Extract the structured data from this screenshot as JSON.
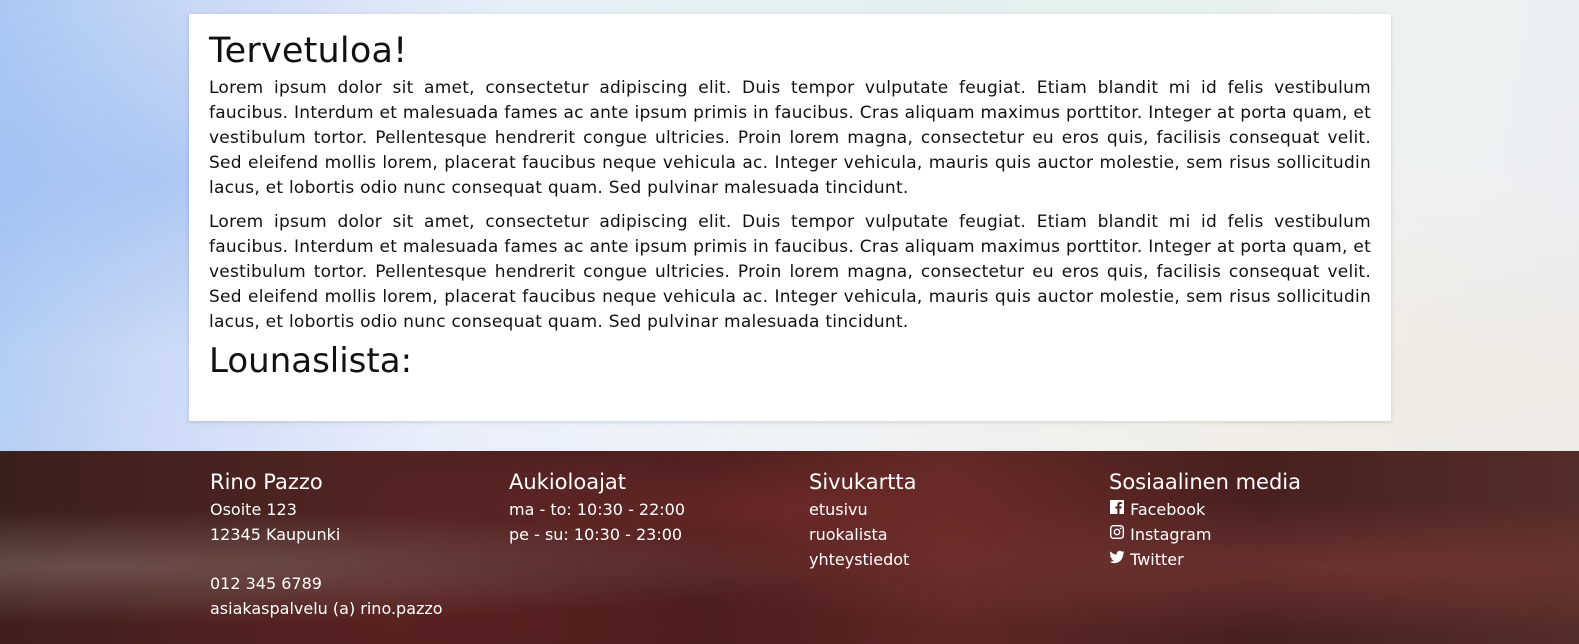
{
  "main": {
    "welcome_title": "Tervetuloa!",
    "paragraphs": [
      "Lorem ipsum dolor sit amet, consectetur adipiscing elit. Duis tempor vulputate feugiat. Etiam blandit mi id felis vestibulum faucibus. Interdum et malesuada fames ac ante ipsum primis in faucibus. Cras aliquam maximus porttitor. Integer at porta quam, et vestibulum tortor. Pellentesque hendrerit congue ultricies. Proin lorem magna, consectetur eu eros quis, facilisis consequat velit. Sed eleifend mollis lorem, placerat faucibus neque vehicula ac. Integer vehicula, mauris quis auctor molestie, sem risus sollicitudin lacus, et lobortis odio nunc consequat quam. Sed pulvinar malesuada tincidunt.",
      "Lorem ipsum dolor sit amet, consectetur adipiscing elit. Duis tempor vulputate feugiat. Etiam blandit mi id felis vestibulum faucibus. Interdum et malesuada fames ac ante ipsum primis in faucibus. Cras aliquam maximus porttitor. Integer at porta quam, et vestibulum tortor. Pellentesque hendrerit congue ultricies. Proin lorem magna, consectetur eu eros quis, facilisis consequat velit. Sed eleifend mollis lorem, placerat faucibus neque vehicula ac. Integer vehicula, mauris quis auctor molestie, sem risus sollicitudin lacus, et lobortis odio nunc consequat quam. Sed pulvinar malesuada tincidunt."
    ],
    "lunch_title": "Lounaslista:"
  },
  "footer": {
    "contact": {
      "title": "Rino Pazzo",
      "address": "Osoite 123",
      "city": "12345 Kaupunki",
      "phone": "012 345 6789",
      "email": "asiakaspalvelu (a) rino.pazzo"
    },
    "hours": {
      "title": "Aukioloajat",
      "weekdays": "ma - to: 10:30 - 22:00",
      "weekend": "pe - su: 10:30 - 23:00"
    },
    "sitemap": {
      "title": "Sivukartta",
      "links": [
        "etusivu",
        "ruokalista",
        "yhteystiedot"
      ]
    },
    "social": {
      "title": "Sosiaalinen media",
      "items": [
        {
          "label": "Facebook",
          "icon": "facebook-icon"
        },
        {
          "label": "Instagram",
          "icon": "instagram-icon"
        },
        {
          "label": "Twitter",
          "icon": "twitter-icon"
        }
      ]
    }
  }
}
